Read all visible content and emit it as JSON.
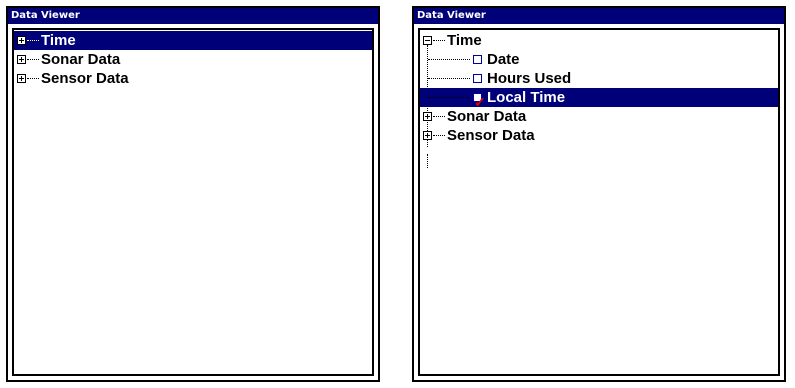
{
  "left_panel": {
    "title": "Data Viewer",
    "tree": [
      {
        "label": "Time",
        "expander": "plus",
        "selected": true
      },
      {
        "label": "Sonar Data",
        "expander": "plus",
        "selected": false
      },
      {
        "label": "Sensor Data",
        "expander": "plus",
        "selected": false
      }
    ]
  },
  "right_panel": {
    "title": "Data Viewer",
    "tree": [
      {
        "label": "Time",
        "expander": "minus",
        "selected": false
      },
      {
        "label": "Date",
        "checkbox": "unchecked",
        "selected": false
      },
      {
        "label": "Hours Used",
        "checkbox": "unchecked",
        "selected": false
      },
      {
        "label": "Local Time",
        "checkbox": "checked",
        "selected": true
      },
      {
        "label": "Sonar Data",
        "expander": "plus",
        "selected": false
      },
      {
        "label": "Sensor Data",
        "expander": "plus",
        "selected": false
      }
    ]
  },
  "colors": {
    "titlebar": "#000078",
    "selection": "#000078",
    "checkmark": "#e00000"
  }
}
